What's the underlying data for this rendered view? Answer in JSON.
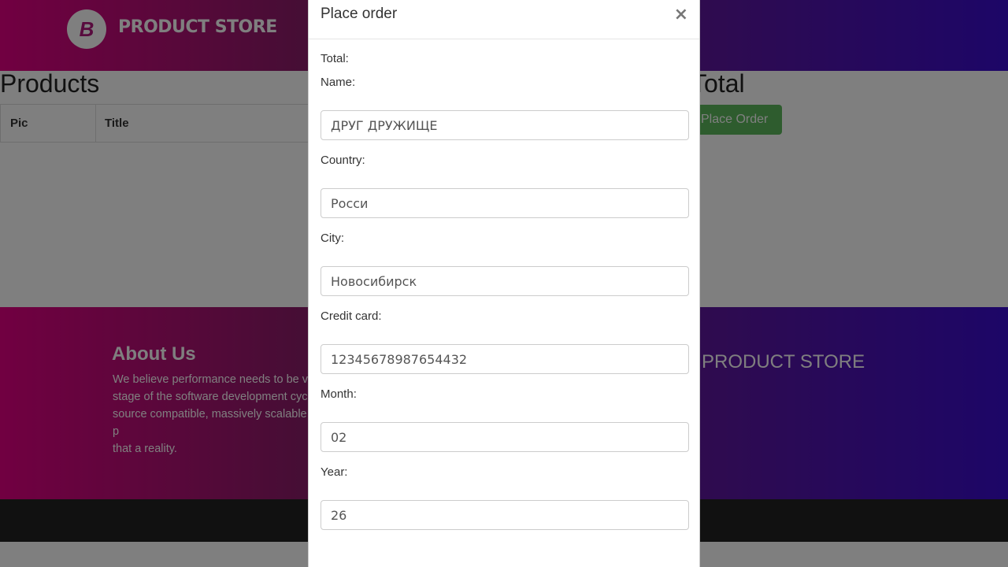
{
  "navbar": {
    "logo_letter": "B",
    "brand": "PRODUCT STORE"
  },
  "products": {
    "title": "Products",
    "columns": [
      "Pic",
      "Title"
    ]
  },
  "total_section": {
    "title": "Total",
    "place_order_button": "Place Order"
  },
  "footer": {
    "about_title": "About Us",
    "about_text": "We believe performance needs to be v\nstage of the software development cyc\nsource compatible, massively scalable p\nthat a reality.",
    "brand": "PRODUCT STORE"
  },
  "modal": {
    "title": "Place order",
    "close": "×",
    "total_label": "Total:",
    "fields": [
      {
        "label": "Name:",
        "value": "ДРУГ ДРУЖИЩЕ"
      },
      {
        "label": "Country:",
        "value": "Росси"
      },
      {
        "label": "City:",
        "value": "Новосибирск"
      },
      {
        "label": "Credit card:",
        "value": "12345678987654432"
      },
      {
        "label": "Month:",
        "value": "02"
      },
      {
        "label": "Year:",
        "value": "26"
      }
    ]
  }
}
